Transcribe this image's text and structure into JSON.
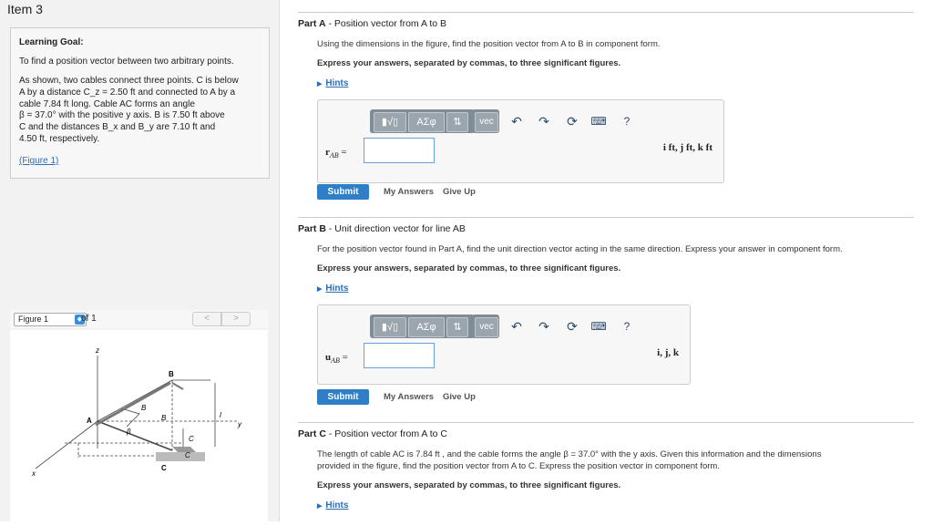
{
  "item_title": "Item 3",
  "goal": {
    "heading": "Learning Goal:",
    "line1": "To find a position vector between two arbitrary points.",
    "body": [
      "As shown, two cables connect three points. C is below",
      "A by a distance C_z = 2.50 ft and connected to A by a",
      "cable 7.84 ft long. Cable AC forms an angle",
      "β = 37.0° with the positive y axis. B is 7.50 ft above",
      "C and the distances B_x and B_y are 7.10 ft and",
      "4.50 ft, respectively."
    ],
    "figure_link": "(Figure 1)"
  },
  "figure_nav": {
    "select": "Figure 1",
    "of": "of 1",
    "prev": "<",
    "next": ">"
  },
  "figure_labels": {
    "z": "z",
    "x": "x",
    "y": "y",
    "A": "A",
    "B": "B",
    "C": "C",
    "By": "B",
    "Bx": "B",
    "beta": "β",
    "Cz": "C",
    "Cx": "C",
    "l": "l"
  },
  "partA": {
    "title_prefix": "Part A",
    "title": "Position vector from A to B",
    "instr": "Using the dimensions in the figure, find the position vector from A to B in component form.",
    "express": "Express your answers, separated by commas, to three significant figures.",
    "hints": "Hints",
    "label": "r",
    "label_sub": "AB",
    "equals": "=",
    "units": "i ft, j ft, k ft",
    "submit": "Submit",
    "my_answers": "My Answers",
    "give_up": "Give Up"
  },
  "partB": {
    "title_prefix": "Part B",
    "title": "Unit direction vector for line AB",
    "instr": "For the position vector found in Part A, find the unit direction vector acting in the same direction. Express your answer in component form.",
    "express": "Express your answers, separated by commas, to three significant figures.",
    "hints": "Hints",
    "label": "u",
    "label_sub": "AB",
    "equals": "=",
    "units": "i, j, k",
    "submit": "Submit",
    "my_answers": "My Answers",
    "give_up": "Give Up"
  },
  "partC": {
    "title_prefix": "Part C",
    "title": "Position vector from A to C",
    "instr1": "The length of cable AC is 7.84 ft , and the cable forms the angle β = 37.0° with the y axis. Given this information and the dimensions",
    "instr2": "provided in the figure, find the position vector from A to C. Express the position vector in component form.",
    "express": "Express your answers, separated by commas, to three significant figures.",
    "hints": "Hints"
  },
  "toolbar": {
    "templates": "▮√▯",
    "greek": "ΑΣφ",
    "arrows": "⇅",
    "vec": "vec",
    "undo": "↶",
    "redo": "↷",
    "reset": "⟳",
    "keyboard": "⌨",
    "help": "?"
  }
}
